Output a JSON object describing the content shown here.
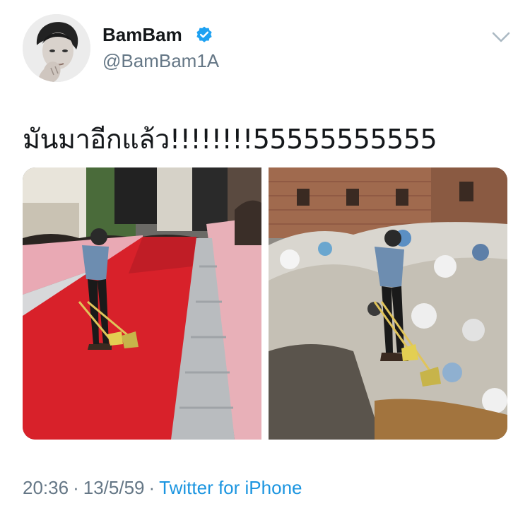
{
  "user": {
    "display_name": "BamBam",
    "handle": "@BamBam1A",
    "verified": true,
    "verified_icon": "verified-badge-icon",
    "avatar_icon": "profile-photo"
  },
  "tweet": {
    "text": "มันมาอีกแล้ว!!!!!!!!55555555555",
    "timestamp": "20:36 · 13/5/59",
    "separator": "·",
    "time": "20:36",
    "date": "13/5/59",
    "source": "Twitter for iPhone"
  },
  "media": {
    "count": 2,
    "images": [
      {
        "name": "red-carpet-photo"
      },
      {
        "name": "garbage-dump-photo"
      }
    ]
  },
  "icons": {
    "more": "chevron-down-icon"
  },
  "colors": {
    "link": "#1b95e0",
    "secondary_text": "#657786",
    "primary_text": "#14171a",
    "verified": "#1da1f2",
    "carpet": "#d8212a"
  }
}
